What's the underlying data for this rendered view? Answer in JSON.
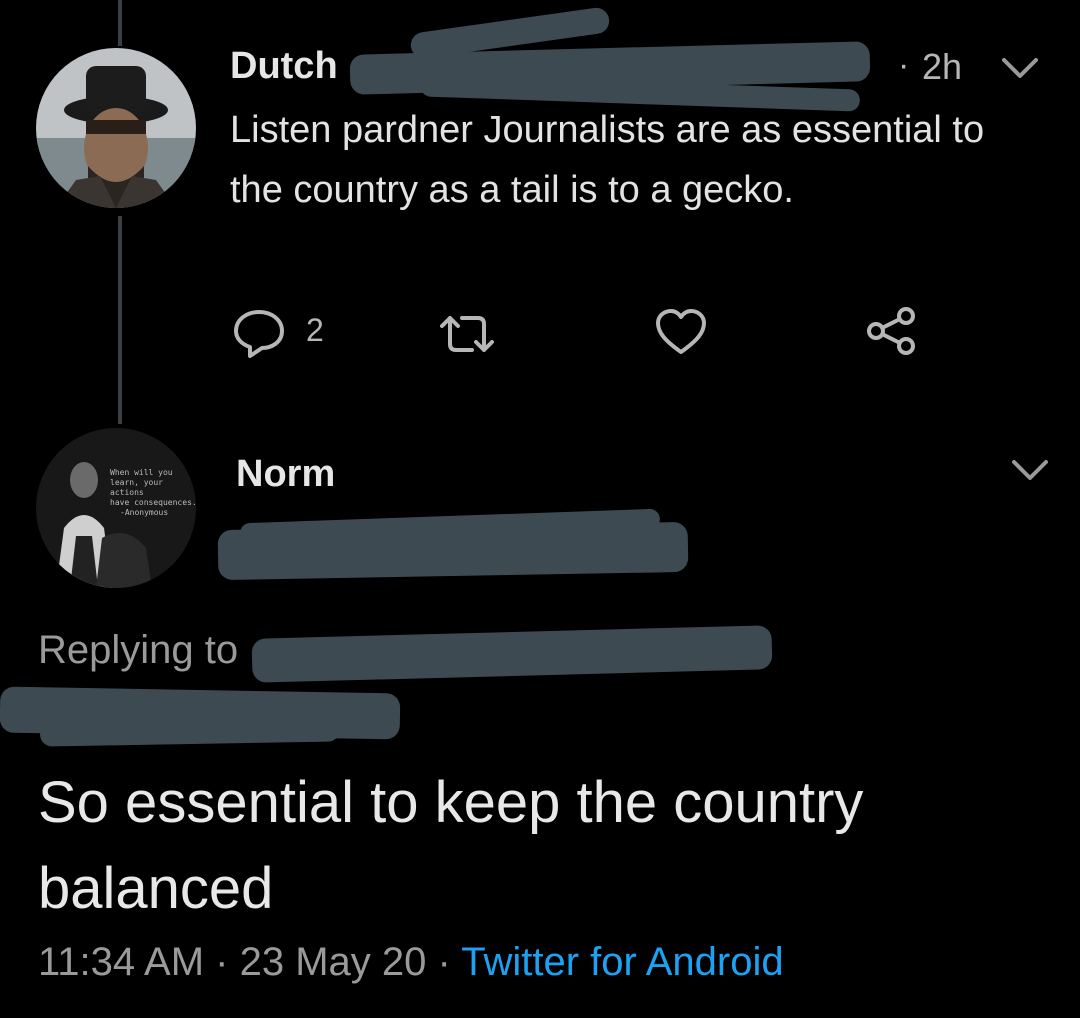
{
  "parent_tweet": {
    "author_name": "Dutch",
    "time_sep": "·",
    "timestamp": "2h",
    "text": "Listen pardner Journalists are as essential to the country as a tail is to a gecko.",
    "reply_count": "2"
  },
  "reply_tweet": {
    "author_name": "Norm",
    "avatar_caption": [
      "When will you",
      "learn, your actions",
      "have consequences.",
      "-Anonymous"
    ],
    "replying_to_label": "Replying to",
    "text": "So essential to keep the country balanced",
    "time": "11:34 AM",
    "sep1": "·",
    "date": "23 May 20",
    "sep2": "·",
    "client": "Twitter for Android"
  },
  "colors": {
    "background": "#000000",
    "text": "#d9d9d9",
    "muted": "#b6b6b6",
    "link": "#1da1f2",
    "redaction": "#3d4a52"
  },
  "icons": [
    "chevron-down-icon",
    "reply-icon",
    "retweet-icon",
    "like-icon",
    "share-icon"
  ]
}
